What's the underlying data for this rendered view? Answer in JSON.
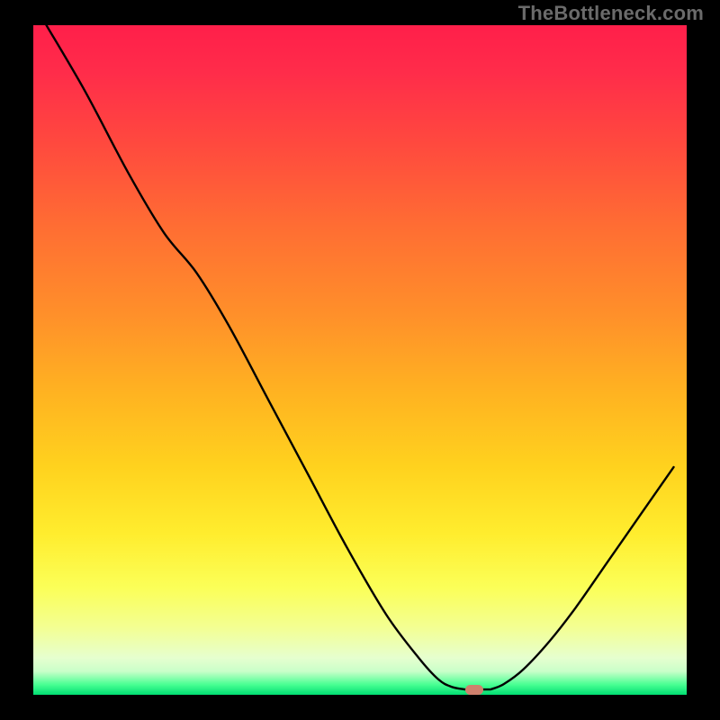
{
  "watermark": "TheBottleneck.com",
  "colors": {
    "frame": "#000000",
    "gradient_stops": [
      {
        "offset": 0.0,
        "color": "#ff1f4a"
      },
      {
        "offset": 0.07,
        "color": "#ff2c4a"
      },
      {
        "offset": 0.18,
        "color": "#ff4a3e"
      },
      {
        "offset": 0.3,
        "color": "#ff6d33"
      },
      {
        "offset": 0.43,
        "color": "#ff8f2a"
      },
      {
        "offset": 0.55,
        "color": "#ffb321"
      },
      {
        "offset": 0.66,
        "color": "#ffd21e"
      },
      {
        "offset": 0.76,
        "color": "#ffed2e"
      },
      {
        "offset": 0.84,
        "color": "#fbff58"
      },
      {
        "offset": 0.9,
        "color": "#f3ff93"
      },
      {
        "offset": 0.945,
        "color": "#e6ffcf"
      },
      {
        "offset": 0.965,
        "color": "#c9ffc9"
      },
      {
        "offset": 0.985,
        "color": "#47ff92"
      },
      {
        "offset": 1.0,
        "color": "#00dd72"
      }
    ],
    "curve": "#000000",
    "marker": "#cf806d"
  },
  "chart_data": {
    "type": "line",
    "title": "",
    "xlabel": "",
    "ylabel": "",
    "xlim": [
      0,
      100
    ],
    "ylim": [
      0,
      100
    ],
    "grid": false,
    "legend": false,
    "marker_x": 67.5,
    "left_branch": [
      {
        "x": 2.0,
        "y": 100.0
      },
      {
        "x": 8.0,
        "y": 90.0
      },
      {
        "x": 14.5,
        "y": 78.0
      },
      {
        "x": 20.0,
        "y": 69.0
      },
      {
        "x": 25.0,
        "y": 63.0
      },
      {
        "x": 30.0,
        "y": 55.0
      },
      {
        "x": 36.0,
        "y": 44.0
      },
      {
        "x": 42.0,
        "y": 33.0
      },
      {
        "x": 48.0,
        "y": 22.0
      },
      {
        "x": 54.0,
        "y": 12.0
      },
      {
        "x": 59.0,
        "y": 5.5
      },
      {
        "x": 62.0,
        "y": 2.3
      },
      {
        "x": 64.0,
        "y": 1.2
      },
      {
        "x": 66.0,
        "y": 0.8
      }
    ],
    "flat_segment": [
      {
        "x": 66.0,
        "y": 0.8
      },
      {
        "x": 70.0,
        "y": 0.8
      }
    ],
    "right_branch": [
      {
        "x": 70.0,
        "y": 0.8
      },
      {
        "x": 72.0,
        "y": 1.6
      },
      {
        "x": 75.0,
        "y": 3.8
      },
      {
        "x": 79.0,
        "y": 8.0
      },
      {
        "x": 83.0,
        "y": 13.0
      },
      {
        "x": 88.0,
        "y": 20.0
      },
      {
        "x": 93.0,
        "y": 27.0
      },
      {
        "x": 98.0,
        "y": 34.0
      }
    ]
  }
}
